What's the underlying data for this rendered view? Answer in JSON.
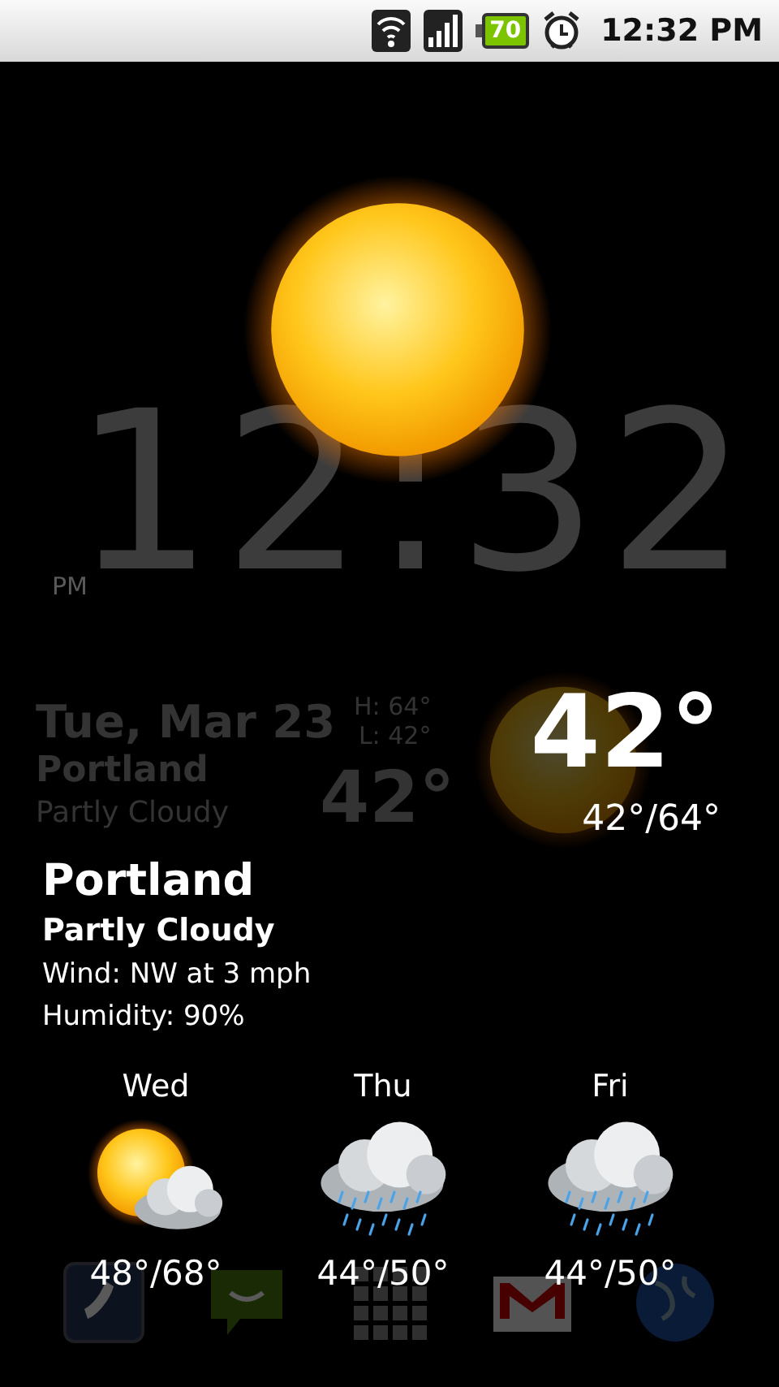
{
  "status_bar": {
    "battery": "70",
    "time": "12:32 PM"
  },
  "clock": {
    "time": "12:32",
    "ampm": "PM"
  },
  "widget": {
    "date": "Tue, Mar 23",
    "high": "H: 64°",
    "low": "L: 42°",
    "city": "Portland",
    "condition": "Partly Cloudy",
    "temp": "42°"
  },
  "current": {
    "temp": "42°",
    "range": "42°/64°"
  },
  "details": {
    "city": "Portland",
    "condition": "Partly Cloudy",
    "wind": "Wind: NW at 3 mph",
    "humidity": "Humidity: 90%"
  },
  "forecast": [
    {
      "day": "Wed",
      "kind": "partly_cloudy",
      "temps": "48°/68°"
    },
    {
      "day": "Thu",
      "kind": "rain",
      "temps": "44°/50°"
    },
    {
      "day": "Fri",
      "kind": "rain",
      "temps": "44°/50°"
    }
  ]
}
